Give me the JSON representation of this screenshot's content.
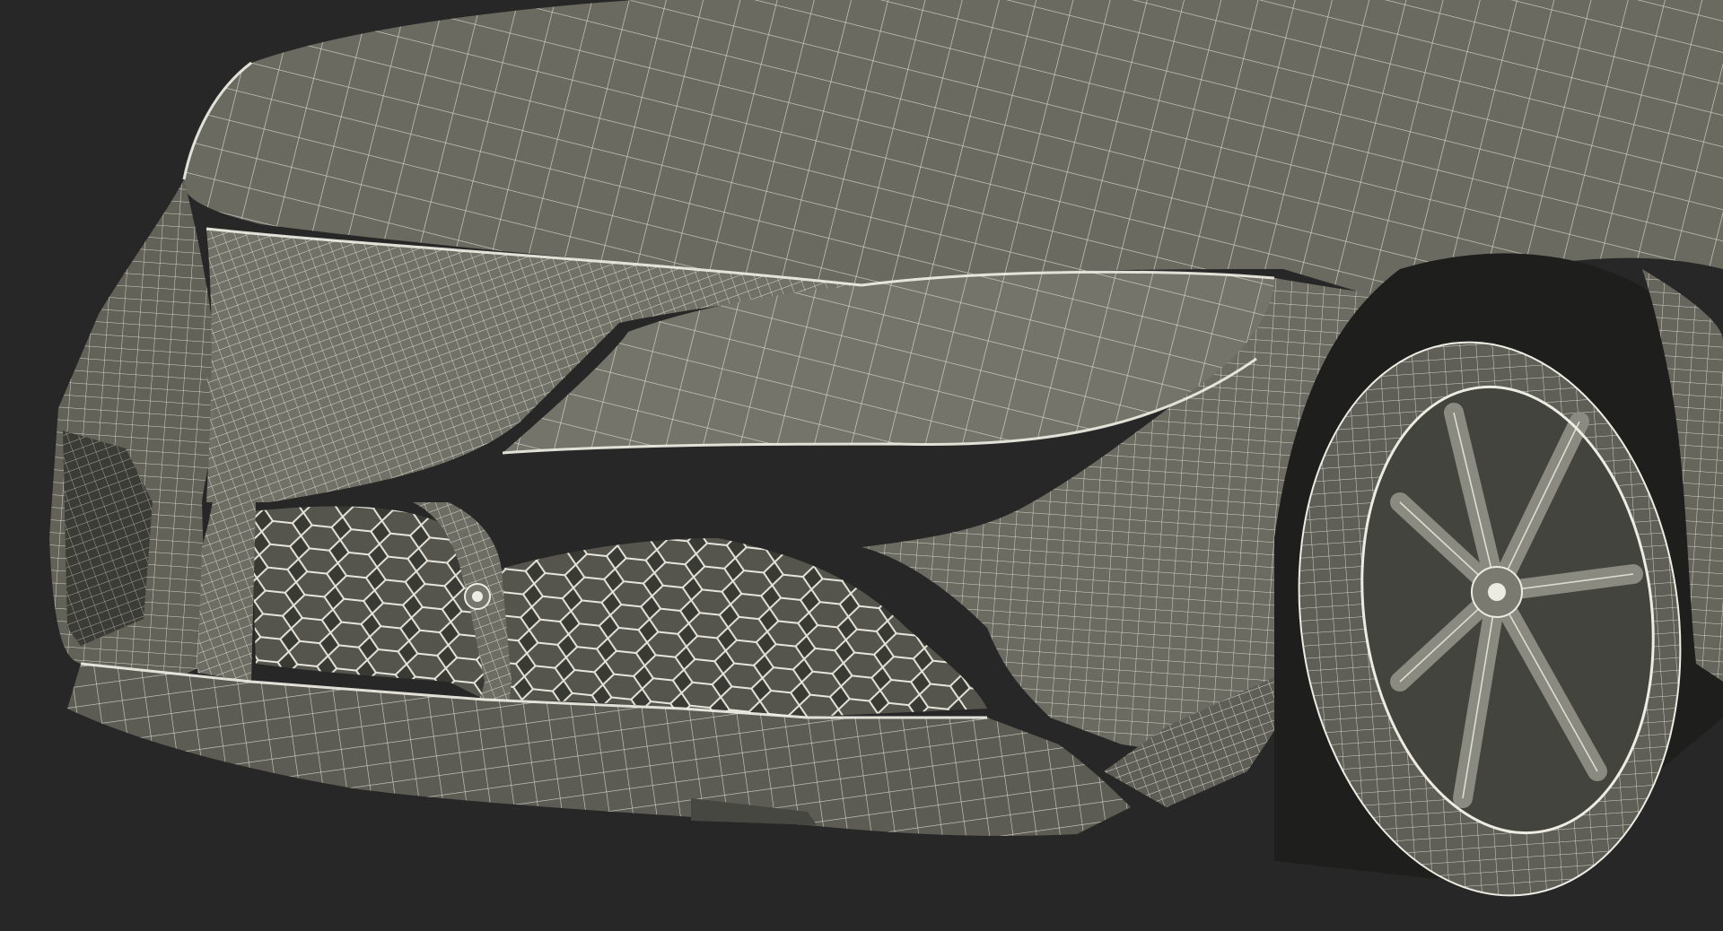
{
  "scene": {
    "subject": "sports-car-front-wireframe",
    "render_style": "wireframe-over-clay",
    "colors": {
      "background": "#272727",
      "surface": "#67675e",
      "surface_light": "#7c7c72",
      "surface_dark": "#4a4a43",
      "wire": "#ecece2",
      "cavity": "#2e2e2b"
    }
  }
}
